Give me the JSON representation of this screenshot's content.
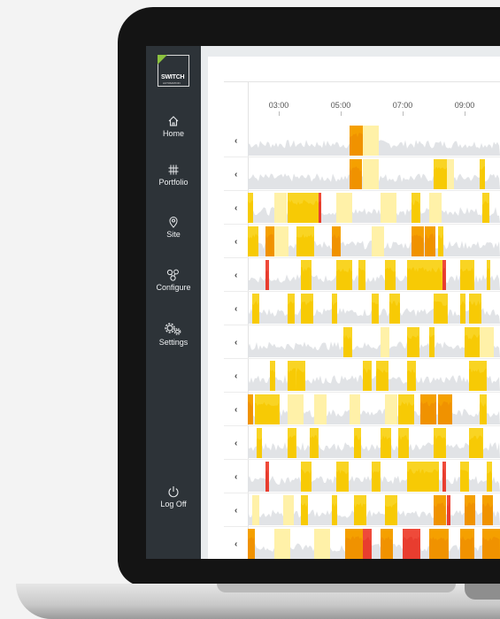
{
  "brand": {
    "name": "SWITCH",
    "sub": "AUTOMATION"
  },
  "nav": [
    {
      "label": "Home",
      "icon": "home-icon"
    },
    {
      "label": "Portfolio",
      "icon": "portfolio-icon"
    },
    {
      "label": "Site",
      "icon": "location-pin-icon"
    },
    {
      "label": "Configure",
      "icon": "configure-icon"
    },
    {
      "label": "Settings",
      "icon": "gears-icon"
    }
  ],
  "logoff": {
    "label": "Log Off",
    "icon": "power-icon"
  },
  "timeline": {
    "labels": [
      "03:00",
      "05:00",
      "07:00",
      "09:00"
    ]
  },
  "rows": 13,
  "colors": {
    "sidebar": "#2d3338",
    "light_yellow": "#fff1a8",
    "yellow": "#f9d423",
    "orange": "#f5a000",
    "red": "#ef4a3a",
    "baseline": "#e1e3e6"
  }
}
